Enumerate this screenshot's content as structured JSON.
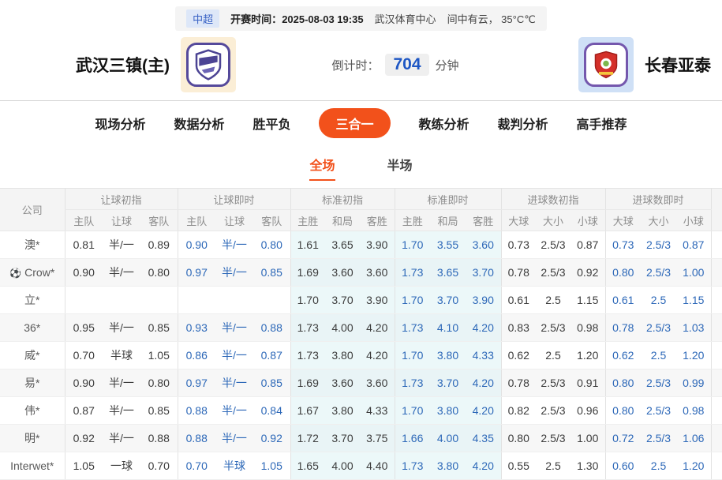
{
  "info_bar": {
    "league": "中超",
    "kickoff_label": "开赛时间：",
    "kickoff_time": "2025-08-03 19:35",
    "venue": "武汉体育中心",
    "weather": "间中有云， 35°C℃"
  },
  "match": {
    "home_name": "武汉三镇(主)",
    "away_name": "长春亚泰",
    "countdown_label": "倒计时：",
    "countdown_value": "704",
    "countdown_unit": "分钟"
  },
  "nav": {
    "items": [
      {
        "label": "现场分析",
        "active": false
      },
      {
        "label": "数据分析",
        "active": false
      },
      {
        "label": "胜平负",
        "active": false
      },
      {
        "label": "三合一",
        "active": true
      },
      {
        "label": "教练分析",
        "active": false
      },
      {
        "label": "裁判分析",
        "active": false
      },
      {
        "label": "高手推荐",
        "active": false
      }
    ]
  },
  "subtabs": {
    "full": "全场",
    "half": "半场",
    "active": "全场"
  },
  "table": {
    "company_header": "公司",
    "groups": [
      {
        "label": "让球初指",
        "cols": [
          "主队",
          "让球",
          "客队"
        ],
        "kind": "init",
        "tint": false
      },
      {
        "label": "让球即时",
        "cols": [
          "主队",
          "让球",
          "客队"
        ],
        "kind": "live",
        "tint": false
      },
      {
        "label": "标准初指",
        "cols": [
          "主胜",
          "和局",
          "客胜"
        ],
        "kind": "init",
        "tint": true
      },
      {
        "label": "标准即时",
        "cols": [
          "主胜",
          "和局",
          "客胜"
        ],
        "kind": "live",
        "tint": true
      },
      {
        "label": "进球数初指",
        "cols": [
          "大球",
          "大小",
          "小球"
        ],
        "kind": "init",
        "tint": false
      },
      {
        "label": "进球数即时",
        "cols": [
          "大球",
          "大小",
          "小球"
        ],
        "kind": "live",
        "tint": false
      }
    ],
    "rows": [
      {
        "company": "澳*",
        "ball_icon": false,
        "cells": [
          [
            "0.81",
            "半/一",
            "0.89"
          ],
          [
            "0.90",
            "半/一",
            "0.80"
          ],
          [
            "1.61",
            "3.65",
            "3.90"
          ],
          [
            "1.70",
            "3.55",
            "3.60"
          ],
          [
            "0.73",
            "2.5/3",
            "0.87"
          ],
          [
            "0.73",
            "2.5/3",
            "0.87"
          ]
        ]
      },
      {
        "company": "Crow*",
        "ball_icon": true,
        "cells": [
          [
            "0.90",
            "半/一",
            "0.80"
          ],
          [
            "0.97",
            "半/一",
            "0.85"
          ],
          [
            "1.69",
            "3.60",
            "3.60"
          ],
          [
            "1.73",
            "3.65",
            "3.70"
          ],
          [
            "0.78",
            "2.5/3",
            "0.92"
          ],
          [
            "0.80",
            "2.5/3",
            "1.00"
          ]
        ]
      },
      {
        "company": "立*",
        "ball_icon": false,
        "cells": [
          [
            "",
            "",
            ""
          ],
          [
            "",
            "",
            ""
          ],
          [
            "1.70",
            "3.70",
            "3.90"
          ],
          [
            "1.70",
            "3.70",
            "3.90"
          ],
          [
            "0.61",
            "2.5",
            "1.15"
          ],
          [
            "0.61",
            "2.5",
            "1.15"
          ]
        ]
      },
      {
        "company": "36*",
        "ball_icon": false,
        "cells": [
          [
            "0.95",
            "半/一",
            "0.85"
          ],
          [
            "0.93",
            "半/一",
            "0.88"
          ],
          [
            "1.73",
            "4.00",
            "4.20"
          ],
          [
            "1.73",
            "4.10",
            "4.20"
          ],
          [
            "0.83",
            "2.5/3",
            "0.98"
          ],
          [
            "0.78",
            "2.5/3",
            "1.03"
          ]
        ]
      },
      {
        "company": "威*",
        "ball_icon": false,
        "cells": [
          [
            "0.70",
            "半球",
            "1.05"
          ],
          [
            "0.86",
            "半/一",
            "0.87"
          ],
          [
            "1.73",
            "3.80",
            "4.20"
          ],
          [
            "1.70",
            "3.80",
            "4.33"
          ],
          [
            "0.62",
            "2.5",
            "1.20"
          ],
          [
            "0.62",
            "2.5",
            "1.20"
          ]
        ]
      },
      {
        "company": "易*",
        "ball_icon": false,
        "cells": [
          [
            "0.90",
            "半/一",
            "0.80"
          ],
          [
            "0.97",
            "半/一",
            "0.85"
          ],
          [
            "1.69",
            "3.60",
            "3.60"
          ],
          [
            "1.73",
            "3.70",
            "4.20"
          ],
          [
            "0.78",
            "2.5/3",
            "0.91"
          ],
          [
            "0.80",
            "2.5/3",
            "0.99"
          ]
        ]
      },
      {
        "company": "伟*",
        "ball_icon": false,
        "cells": [
          [
            "0.87",
            "半/一",
            "0.85"
          ],
          [
            "0.88",
            "半/一",
            "0.84"
          ],
          [
            "1.67",
            "3.80",
            "4.33"
          ],
          [
            "1.70",
            "3.80",
            "4.20"
          ],
          [
            "0.82",
            "2.5/3",
            "0.96"
          ],
          [
            "0.80",
            "2.5/3",
            "0.98"
          ]
        ]
      },
      {
        "company": "明*",
        "ball_icon": false,
        "cells": [
          [
            "0.92",
            "半/一",
            "0.88"
          ],
          [
            "0.88",
            "半/一",
            "0.92"
          ],
          [
            "1.72",
            "3.70",
            "3.75"
          ],
          [
            "1.66",
            "4.00",
            "4.35"
          ],
          [
            "0.80",
            "2.5/3",
            "1.00"
          ],
          [
            "0.72",
            "2.5/3",
            "1.06"
          ]
        ]
      },
      {
        "company": "Interwet*",
        "ball_icon": false,
        "cells": [
          [
            "1.05",
            "一球",
            "0.70"
          ],
          [
            "0.70",
            "半球",
            "1.05"
          ],
          [
            "1.65",
            "4.00",
            "4.40"
          ],
          [
            "1.73",
            "3.80",
            "4.20"
          ],
          [
            "0.55",
            "2.5",
            "1.30"
          ],
          [
            "0.60",
            "2.5",
            "1.20"
          ]
        ]
      }
    ]
  },
  "colors": {
    "accent_orange": "#f2511b",
    "live_odds_blue": "#2d68b8",
    "countdown_blue": "#1d56c4",
    "league_tag_blue": "#3a63c5",
    "tint_cyan": "#ecf8f9"
  }
}
